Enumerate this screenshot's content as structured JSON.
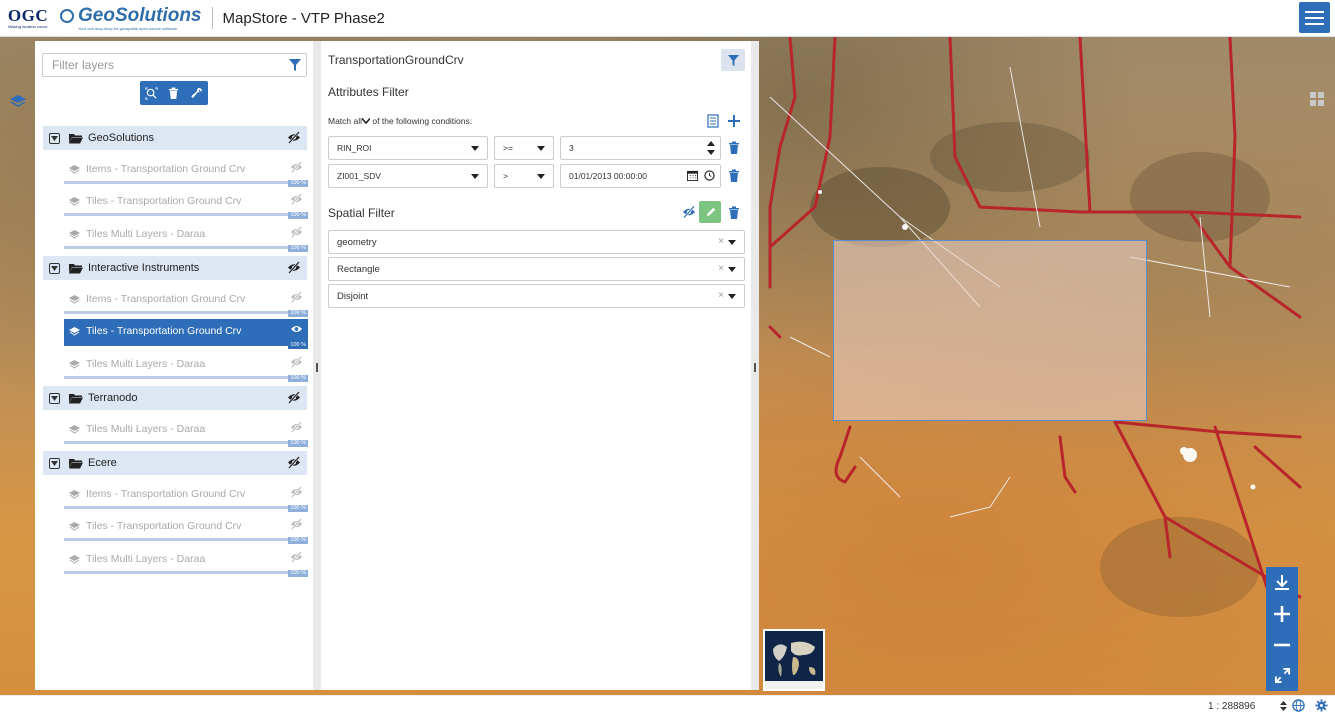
{
  "header": {
    "ogc_logo_text": "OGC",
    "ogc_logo_sub": "Making location count.",
    "brand_name": "GeoSolutions",
    "brand_tagline": "Your one-stop-shop for geospatial open source software",
    "app_title": "MapStore - VTP Phase2"
  },
  "toc": {
    "filter_placeholder": "Filter layers",
    "groups": [
      {
        "name": "GeoSolutions",
        "layers": [
          {
            "name": "Items - Transportation Ground Crv",
            "opacity": "100 %"
          },
          {
            "name": "Tiles - Transportation Ground Crv",
            "opacity": "100 %"
          },
          {
            "name": "Tiles Multi Layers - Daraa",
            "opacity": "100 %"
          }
        ]
      },
      {
        "name": "Interactive Instruments",
        "layers": [
          {
            "name": "Items - Transportation Ground Crv",
            "opacity": "100 %"
          },
          {
            "name": "Tiles - Transportation Ground Crv",
            "opacity": "100 %"
          },
          {
            "name": "Tiles Multi Layers - Daraa",
            "opacity": "100 %"
          }
        ]
      },
      {
        "name": "Terranodo",
        "layers": [
          {
            "name": "Tiles Multi Layers - Daraa",
            "opacity": "100 %"
          }
        ]
      },
      {
        "name": "Ecere",
        "layers": [
          {
            "name": "Items - Transportation Ground Crv",
            "opacity": "100 %"
          },
          {
            "name": "Tiles - Transportation Ground Crv",
            "opacity": "100 %"
          },
          {
            "name": "Tiles Multi Layers - Daraa",
            "opacity": "100 %"
          }
        ]
      }
    ]
  },
  "query_panel": {
    "layer_title": "TransportationGroundCrv",
    "attributes_heading": "Attributes Filter",
    "match_prefix": "Match",
    "match_value": "all",
    "match_suffix": "of the following conditions:",
    "conditions": [
      {
        "attribute": "RIN_ROI",
        "operator": ">=",
        "value": "3"
      },
      {
        "attribute": "ZI001_SDV",
        "operator": ">",
        "value": "01/01/2013 00:00:00"
      }
    ],
    "spatial_heading": "Spatial Filter",
    "spatial_attribute": "geometry",
    "spatial_method": "Rectangle",
    "spatial_operation": "Disjoint"
  },
  "footer": {
    "scale": "1 : 288896"
  },
  "colors": {
    "accent": "#2e6db7",
    "group_bg": "#dde6f3",
    "road_red": "#b8252a",
    "selection_border": "#5b8ed1"
  },
  "icons": [
    "hamburger-icon",
    "funnel-icon",
    "zoom-to-layer-icon",
    "trash-icon",
    "wrench-icon",
    "eye-slash-icon",
    "eye-icon",
    "folder-open-icon",
    "layers-icon",
    "add-icon",
    "list-icon",
    "calendar-icon",
    "clock-icon",
    "pencil-icon",
    "download-icon",
    "zoom-in-icon",
    "zoom-out-icon",
    "fullscreen-icon",
    "globe-icon",
    "gear-icon"
  ]
}
